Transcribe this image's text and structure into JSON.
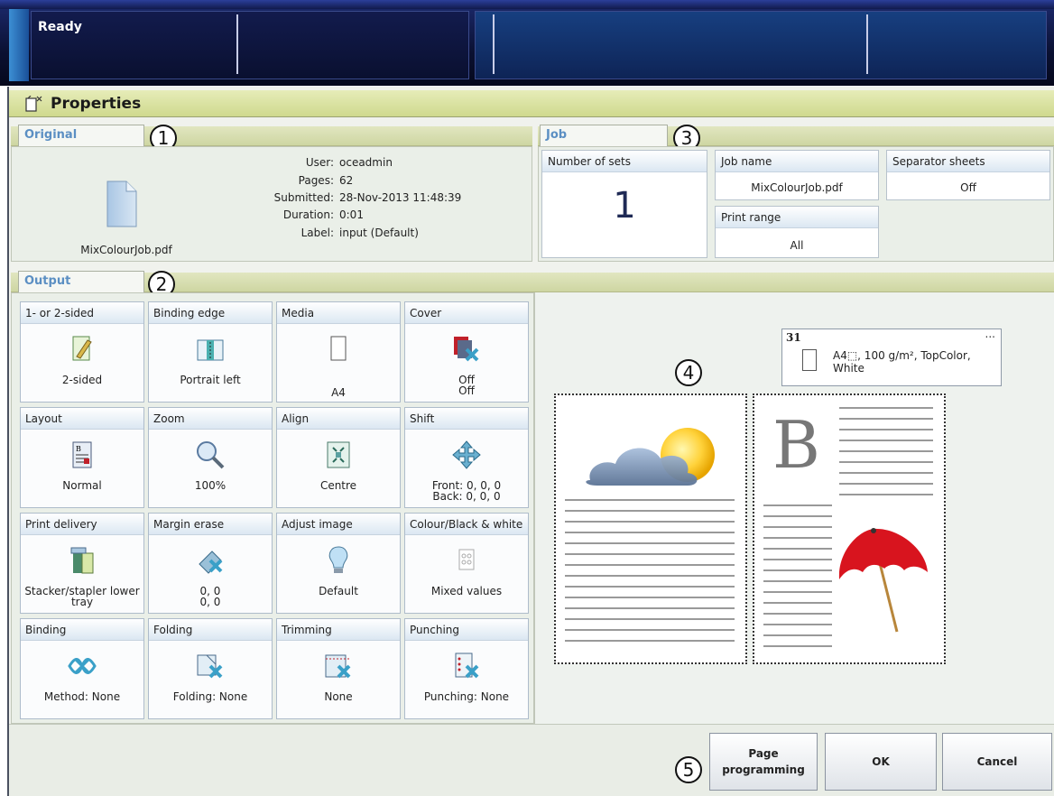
{
  "status": {
    "text": "Ready"
  },
  "properties": {
    "title": "Properties"
  },
  "original": {
    "tab_label": "Original",
    "callout": "1",
    "filename": "MixColourJob.pdf",
    "info": [
      {
        "label": "User:",
        "value": "oceadmin"
      },
      {
        "label": "Pages:",
        "value": "62"
      },
      {
        "label": "Submitted:",
        "value": "28-Nov-2013 11:48:39"
      },
      {
        "label": "Duration:",
        "value": "0:01"
      },
      {
        "label": "Label:",
        "value": "input (Default)"
      }
    ]
  },
  "job": {
    "tab_label": "Job",
    "callout": "3",
    "number_of_sets": {
      "label": "Number of sets",
      "value": "1"
    },
    "job_name": {
      "label": "Job name",
      "value": "MixColourJob.pdf"
    },
    "print_range": {
      "label": "Print range",
      "value": "All"
    },
    "separator_sheets": {
      "label": "Separator sheets",
      "value": "Off"
    }
  },
  "output": {
    "tab_label": "Output",
    "callout": "2",
    "tiles": [
      {
        "label": "1- or 2-sided",
        "icon": "two-sided-icon",
        "values": [
          "2-sided"
        ]
      },
      {
        "label": "Binding edge",
        "icon": "binding-edge-icon",
        "values": [
          "Portrait left"
        ]
      },
      {
        "label": "Media",
        "icon": "media-icon",
        "values": [
          "A4"
        ]
      },
      {
        "label": "Cover",
        "icon": "cover-icon",
        "values": [
          "Off",
          "Off"
        ]
      },
      {
        "label": "Layout",
        "icon": "layout-icon",
        "values": [
          "Normal"
        ]
      },
      {
        "label": "Zoom",
        "icon": "zoom-icon",
        "values": [
          "100%"
        ]
      },
      {
        "label": "Align",
        "icon": "align-icon",
        "values": [
          "Centre"
        ]
      },
      {
        "label": "Shift",
        "icon": "shift-icon",
        "values": [
          "Front: 0, 0, 0",
          "Back: 0, 0, 0"
        ]
      },
      {
        "label": "Print delivery",
        "icon": "print-delivery-icon",
        "values": [
          "Stacker/stapler lower",
          "tray"
        ]
      },
      {
        "label": "Margin erase",
        "icon": "margin-erase-icon",
        "values": [
          "0, 0",
          "0, 0"
        ]
      },
      {
        "label": "Adjust image",
        "icon": "adjust-image-icon",
        "values": [
          "Default"
        ]
      },
      {
        "label": "Colour/Black & white",
        "icon": "colour-mode-icon",
        "values": [
          "Mixed values"
        ]
      },
      {
        "label": "Binding",
        "icon": "binding-icon",
        "values": [
          "Method: None"
        ]
      },
      {
        "label": "Folding",
        "icon": "folding-icon",
        "values": [
          "Folding: None"
        ]
      },
      {
        "label": "Trimming",
        "icon": "trimming-icon",
        "values": [
          "None"
        ]
      },
      {
        "label": "Punching",
        "icon": "punching-icon",
        "values": [
          "Punching: None"
        ]
      }
    ]
  },
  "preview": {
    "callout": "4",
    "media": {
      "number": "31",
      "description": "A4⬚, 100 g/m², TopColor, White",
      "more": "..."
    },
    "page_letter": "B"
  },
  "buttons": {
    "callout": "5",
    "page_programming": "Page programming",
    "ok": "OK",
    "cancel": "Cancel"
  },
  "colors": {
    "accent": "#5b8fc3",
    "header_band": "#cfd98e",
    "topbar": "#0b1133"
  }
}
